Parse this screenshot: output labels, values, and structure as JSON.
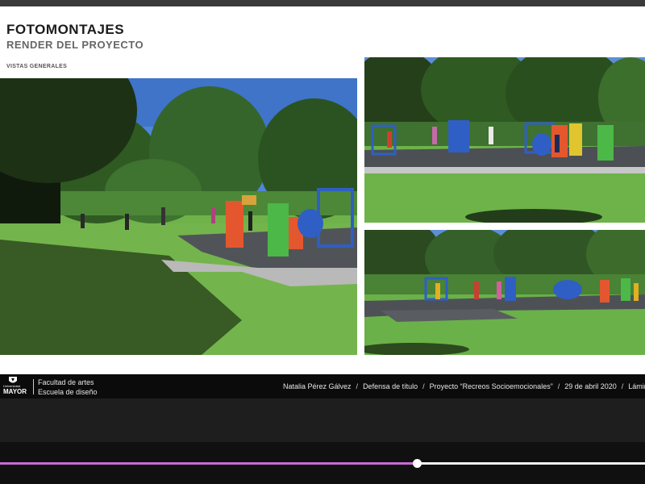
{
  "slide": {
    "title": "FOTOMONTAJES",
    "subtitle": "RENDER DEL PROYECTO",
    "section_label": "VISTAS GENERALES"
  },
  "footer": {
    "logo_small": "Universidad",
    "logo_big": "MAYOR",
    "faculty_line1": "Facultad de artes",
    "faculty_line2": "Escuela de diseño",
    "author": "Natalia Pérez Gálvez",
    "event": "Defensa  de título",
    "project": "Proyecto “Recreos Socioemocionales”",
    "date": "29 de abril 2020",
    "page_label": "Lámina"
  },
  "player": {
    "progress": 0.646
  },
  "colors": {
    "progress_fill": "#c86ad6",
    "sky": "#4f86d8",
    "grass": "#6fb24a",
    "playground_orange": "#e4572e",
    "playground_green": "#4cb848",
    "playground_blue": "#2f5fc4"
  }
}
